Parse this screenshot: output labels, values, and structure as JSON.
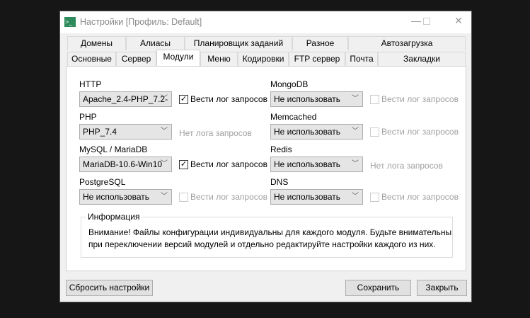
{
  "window": {
    "title": "Настройки [Профиль: Default]",
    "icon": "terminal-icon"
  },
  "tabs_row1": [
    "Домены",
    "Алиасы",
    "Планировщик заданий",
    "Разное",
    "Автозагрузка"
  ],
  "tabs_row2": [
    "Основные",
    "Сервер",
    "Модули",
    "Меню",
    "Кодировки",
    "FTP сервер",
    "Почта",
    "Закладки"
  ],
  "selected_tab": "Модули",
  "modules": [
    {
      "label": "HTTP",
      "value": "Apache_2.4-PHP_7.2-",
      "log": "Вести лог запросов",
      "checked": true,
      "enabled": true
    },
    {
      "label": "PHP",
      "value": "PHP_7.4",
      "log": "Нет лога запросов",
      "nolog": true
    },
    {
      "label": "MySQL / MariaDB",
      "value": "MariaDB-10.6-Win10",
      "log": "Вести лог запросов",
      "checked": true,
      "enabled": true
    },
    {
      "label": "PostgreSQL",
      "value": "Не использовать",
      "log": "Вести лог запросов",
      "checked": false,
      "enabled": false
    },
    {
      "label": "MongoDB",
      "value": "Не использовать",
      "log": "Вести лог запросов",
      "checked": false,
      "enabled": false
    },
    {
      "label": "Memcached",
      "value": "Не использовать",
      "log": "Вести лог запросов",
      "checked": false,
      "enabled": false
    },
    {
      "label": "Redis",
      "value": "Не использовать",
      "log": "Нет лога запросов",
      "nolog": true
    },
    {
      "label": "DNS",
      "value": "Не использовать",
      "log": "Вести лог запросов",
      "checked": false,
      "enabled": false
    }
  ],
  "info": {
    "title": "Информация",
    "line1": "Внимание! Файлы конфигурации индивидуальны для каждого модуля. Будьте внимательны",
    "line2": "при переключении версий модулей и отдельно редактируйте настройки каждого из них."
  },
  "buttons": {
    "reset": "Сбросить настройки",
    "save": "Сохранить",
    "close": "Закрыть"
  }
}
